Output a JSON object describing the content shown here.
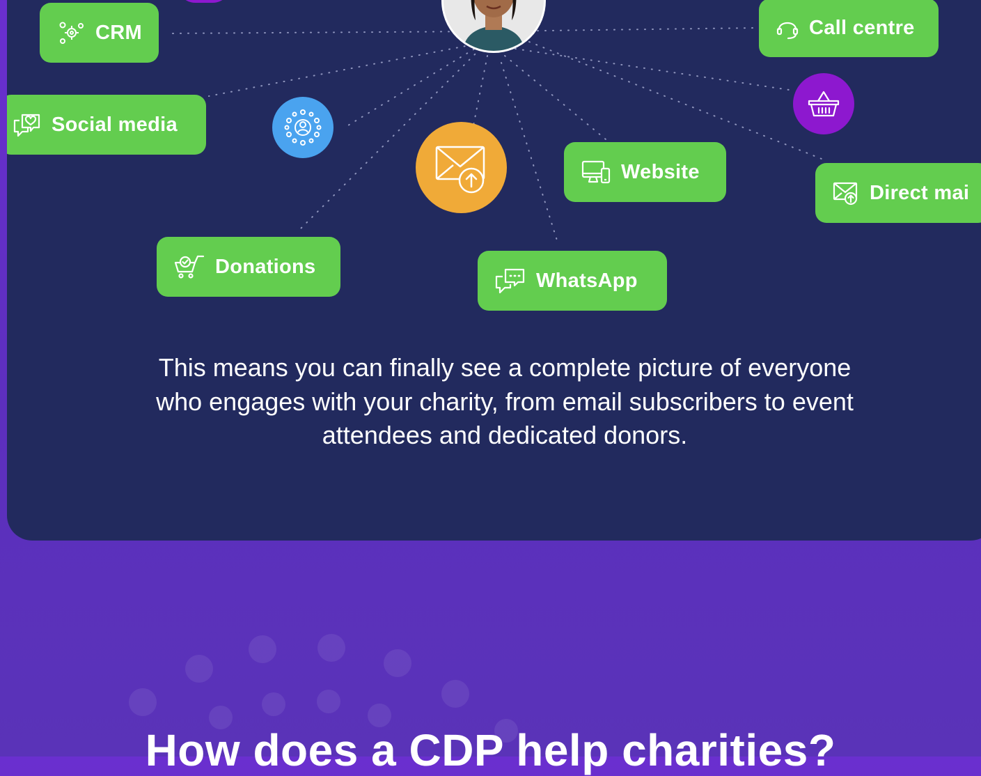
{
  "channels": {
    "crm": "CRM",
    "call_centre": "Call centre",
    "social_media": "Social media",
    "website": "Website",
    "direct_mail": "Direct mai",
    "donations": "Donations",
    "whatsapp": "WhatsApp"
  },
  "description": "This means you can finally see a complete picture of everyone who engages with your charity, from email subscribers to event attendees and dedicated donors.",
  "next_heading": "How does a CDP help charities?",
  "colors": {
    "panel": "#222a5e",
    "pill": "#63cd4f",
    "background": "#5c2fbe",
    "email_circle": "#f0aa38",
    "people_circle": "#4aa3ef",
    "basket_circle": "#8d18cf"
  },
  "icons": [
    "gears-icon",
    "headset-icon",
    "chat-heart-icon",
    "people-network-icon",
    "email-upload-icon",
    "monitor-phone-icon",
    "basket-icon",
    "mail-upload-icon",
    "cart-check-icon",
    "chat-bubbles-icon"
  ]
}
